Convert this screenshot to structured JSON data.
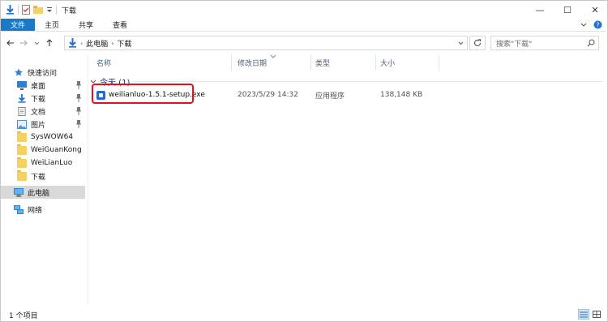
{
  "window": {
    "title": "下载",
    "controls": {
      "minimize": "—",
      "maximize": "☐",
      "close": "✕"
    }
  },
  "ribbon": {
    "tabs": [
      {
        "label": "文件",
        "active": true
      },
      {
        "label": "主页"
      },
      {
        "label": "共享"
      },
      {
        "label": "查看"
      }
    ]
  },
  "addressbar": {
    "breadcrumbs": [
      "此电脑",
      "下载"
    ],
    "search_placeholder": "搜索\"下载\""
  },
  "sidebar": {
    "items": [
      {
        "label": "快速访问",
        "icon": "star-icon",
        "pinned": false
      },
      {
        "label": "桌面",
        "icon": "desktop-icon",
        "pinned": true
      },
      {
        "label": "下载",
        "icon": "download-arrow-icon",
        "pinned": true
      },
      {
        "label": "文档",
        "icon": "document-icon",
        "pinned": true
      },
      {
        "label": "图片",
        "icon": "pictures-icon",
        "pinned": true
      },
      {
        "label": "SysWOW64",
        "icon": "folder-icon",
        "pinned": false
      },
      {
        "label": "WeiGuanKong",
        "icon": "folder-icon",
        "pinned": false
      },
      {
        "label": "WeiLianLuo",
        "icon": "folder-icon",
        "pinned": false
      },
      {
        "label": "下载",
        "icon": "folder-icon",
        "pinned": false
      },
      {
        "label": "此电脑",
        "icon": "computer-icon",
        "selected": true
      },
      {
        "label": "网络",
        "icon": "network-icon"
      }
    ]
  },
  "columns": [
    "名称",
    "修改日期",
    "类型",
    "大小"
  ],
  "group": {
    "label": "今天 (1)"
  },
  "files": [
    {
      "name": "weilianluo-1.5.1-setup.exe",
      "modified": "2023/5/29 14:32",
      "type": "应用程序",
      "size": "138,148 KB",
      "highlighted": true
    }
  ],
  "status": {
    "text": "1 个项目"
  },
  "colors": {
    "accent": "#1979ca",
    "highlight": "#e3111d",
    "group_text": "#1e3287"
  }
}
